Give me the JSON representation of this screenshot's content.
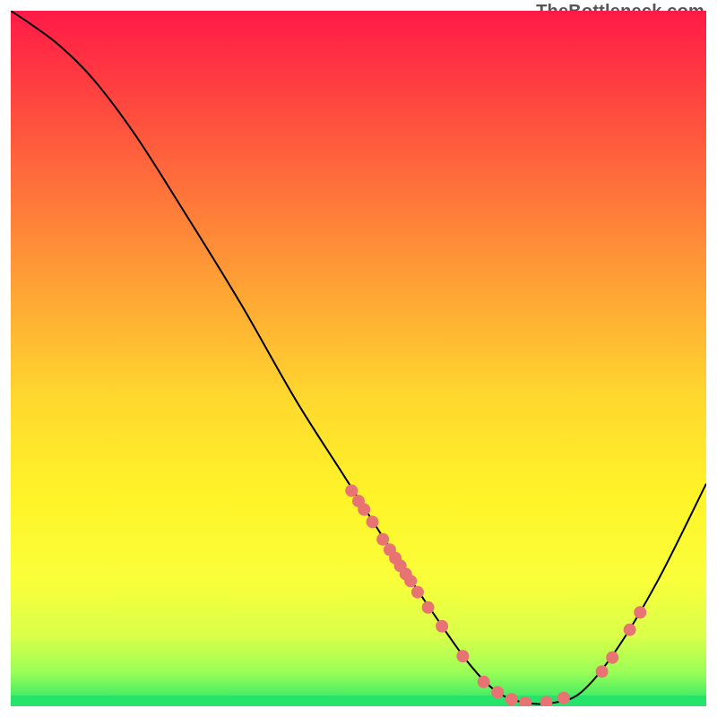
{
  "watermark": "TheBottleneck.com",
  "chart_data": {
    "type": "line",
    "title": "",
    "xlabel": "",
    "ylabel": "",
    "xlim": [
      0,
      100
    ],
    "ylim": [
      0,
      100
    ],
    "curve": [
      {
        "x": 0,
        "y": 100
      },
      {
        "x": 3,
        "y": 98
      },
      {
        "x": 7,
        "y": 95
      },
      {
        "x": 12,
        "y": 90
      },
      {
        "x": 18,
        "y": 82
      },
      {
        "x": 25,
        "y": 71
      },
      {
        "x": 33,
        "y": 58
      },
      {
        "x": 41,
        "y": 44
      },
      {
        "x": 48,
        "y": 33
      },
      {
        "x": 55,
        "y": 22
      },
      {
        "x": 61,
        "y": 13
      },
      {
        "x": 66,
        "y": 6
      },
      {
        "x": 70,
        "y": 2
      },
      {
        "x": 74,
        "y": 0.5
      },
      {
        "x": 78,
        "y": 0.5
      },
      {
        "x": 82,
        "y": 2
      },
      {
        "x": 87,
        "y": 8
      },
      {
        "x": 93,
        "y": 18
      },
      {
        "x": 100,
        "y": 32
      }
    ],
    "marker_points": [
      {
        "x": 49,
        "y": 31
      },
      {
        "x": 50,
        "y": 29.5
      },
      {
        "x": 50.8,
        "y": 28.3
      },
      {
        "x": 52,
        "y": 26.5
      },
      {
        "x": 53.5,
        "y": 24
      },
      {
        "x": 54.5,
        "y": 22.5
      },
      {
        "x": 55.3,
        "y": 21.3
      },
      {
        "x": 56,
        "y": 20.2
      },
      {
        "x": 56.8,
        "y": 19
      },
      {
        "x": 57.5,
        "y": 18
      },
      {
        "x": 58.5,
        "y": 16.4
      },
      {
        "x": 60,
        "y": 14.2
      },
      {
        "x": 62,
        "y": 11.5
      },
      {
        "x": 65,
        "y": 7.2
      },
      {
        "x": 68,
        "y": 3.5
      },
      {
        "x": 70,
        "y": 2
      },
      {
        "x": 72,
        "y": 1
      },
      {
        "x": 74,
        "y": 0.5
      },
      {
        "x": 77,
        "y": 0.6
      },
      {
        "x": 79.5,
        "y": 1.2
      },
      {
        "x": 85,
        "y": 5
      },
      {
        "x": 86.5,
        "y": 7
      },
      {
        "x": 89,
        "y": 11
      },
      {
        "x": 90.5,
        "y": 13.5
      }
    ],
    "colors": {
      "curve": "#000000",
      "markers": "#e87373",
      "gradient_top": "#ff1a47",
      "gradient_bottom": "#26e46a"
    }
  }
}
